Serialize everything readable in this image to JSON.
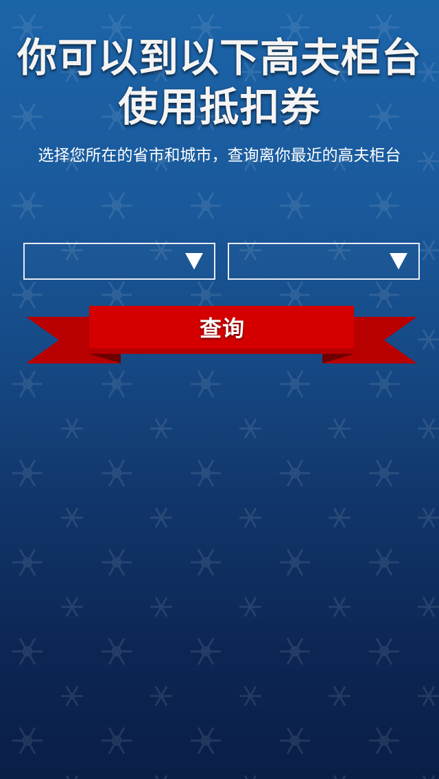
{
  "header": {
    "title_line_1": "你可以到以下高夫柜台",
    "title_line_2": "使用抵扣券",
    "subtitle": "选择您所在的省市和城市，查询离你最近的高夫柜台"
  },
  "selectors": {
    "province": {
      "selected": ""
    },
    "city": {
      "selected": ""
    },
    "arrow_icon": "triangle-down"
  },
  "query_button": {
    "label": "查询"
  },
  "colors": {
    "background_top": "#1c64a8",
    "background_bottom": "#0a1f48",
    "ribbon_red": "#d40000",
    "ribbon_dark": "#9c0000",
    "text": "#ffffff"
  }
}
